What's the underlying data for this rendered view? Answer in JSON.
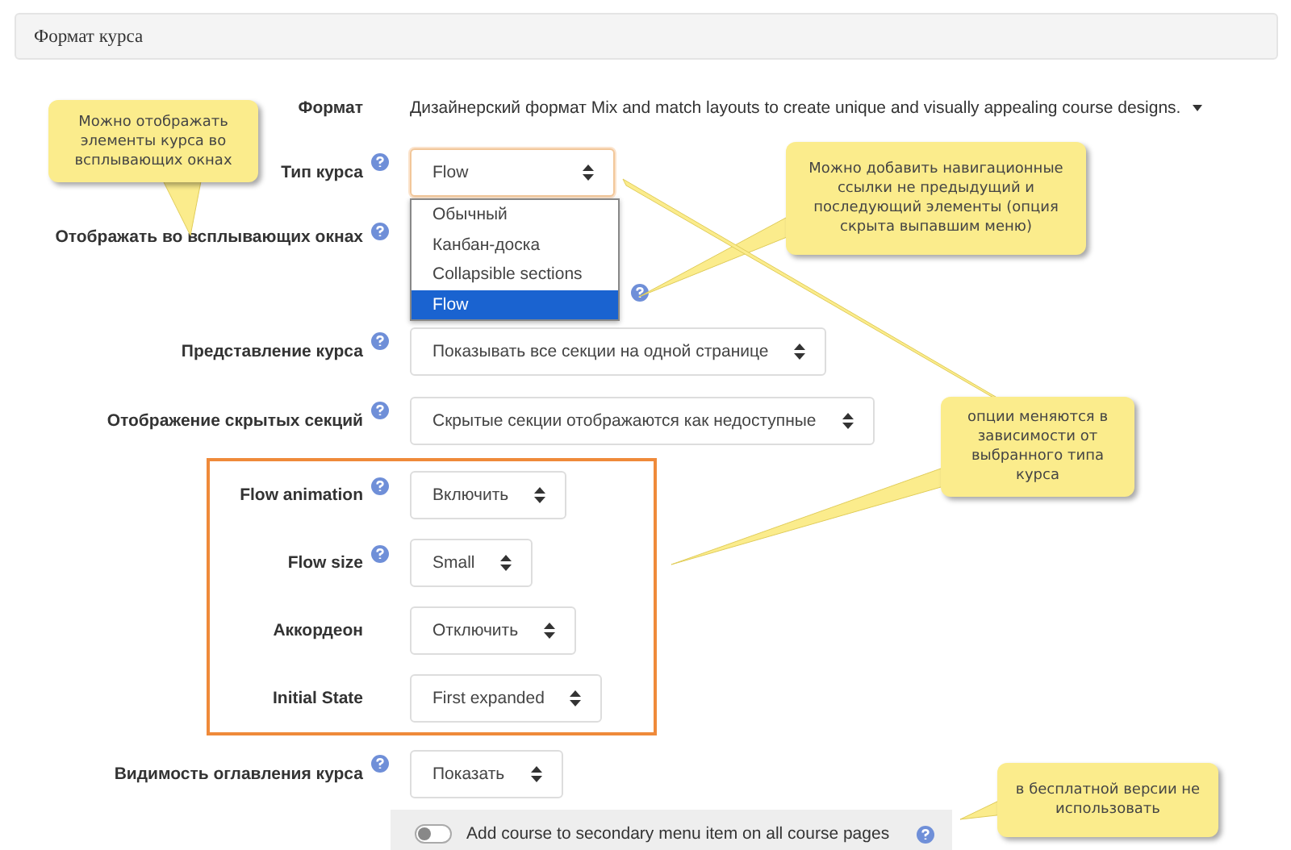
{
  "section_header": {
    "title": "Формат курса"
  },
  "format_row": {
    "label": "Формат",
    "value": "Дизайнерский формат Mix and match layouts to create unique and visually appealing course designs."
  },
  "rows": [
    {
      "kind": "select",
      "label": "Тип курса",
      "help": true,
      "value": "Flow",
      "focused": true,
      "highlighted": false,
      "dropdown": [
        {
          "label": "Обычный",
          "selected": false
        },
        {
          "label": "Канбан-доска",
          "selected": false
        },
        {
          "label": "Collapsible sections",
          "selected": false
        },
        {
          "label": "Flow",
          "selected": true
        }
      ]
    },
    {
      "kind": "covered",
      "label": "Отображать во всплывающих окнах",
      "help": true,
      "highlighted": false
    },
    {
      "kind": "covered-help",
      "help": true,
      "highlighted": false
    },
    {
      "kind": "select",
      "label": "Представление курса",
      "help": true,
      "value": "Показывать все секции на одной странице",
      "focused": false,
      "highlighted": false
    },
    {
      "kind": "select",
      "label": "Отображение скрытых секций",
      "help": true,
      "value": "Скрытые секции отображаются как недоступные",
      "focused": false,
      "highlighted": false
    },
    {
      "kind": "select",
      "label": "Flow animation",
      "help": true,
      "value": "Включить",
      "focused": false,
      "highlighted": true
    },
    {
      "kind": "select",
      "label": "Flow size",
      "help": true,
      "value": "Small",
      "focused": false,
      "highlighted": true
    },
    {
      "kind": "select",
      "label": "Аккордеон",
      "help": false,
      "value": "Отключить",
      "focused": false,
      "highlighted": true
    },
    {
      "kind": "select",
      "label": "Initial State",
      "help": false,
      "value": "First expanded",
      "focused": false,
      "highlighted": true
    },
    {
      "kind": "select",
      "label": "Видимость оглавления курса",
      "help": true,
      "value": "Показать",
      "focused": false,
      "highlighted": false
    }
  ],
  "toggle_row": {
    "label": "Add course to secondary menu item on all course pages",
    "on": false,
    "help": true
  },
  "callouts": [
    {
      "text": "Можно отображать элементы курса во всплывающих окнах"
    },
    {
      "text": "Можно добавить навигационные ссылки не предыдущий и последующий элементы (опция скрыта выпавшим меню)"
    },
    {
      "text": "опции меняются в зависимости от выбранного типа курса"
    },
    {
      "text": "в бесплатной версии не использовать"
    }
  ]
}
